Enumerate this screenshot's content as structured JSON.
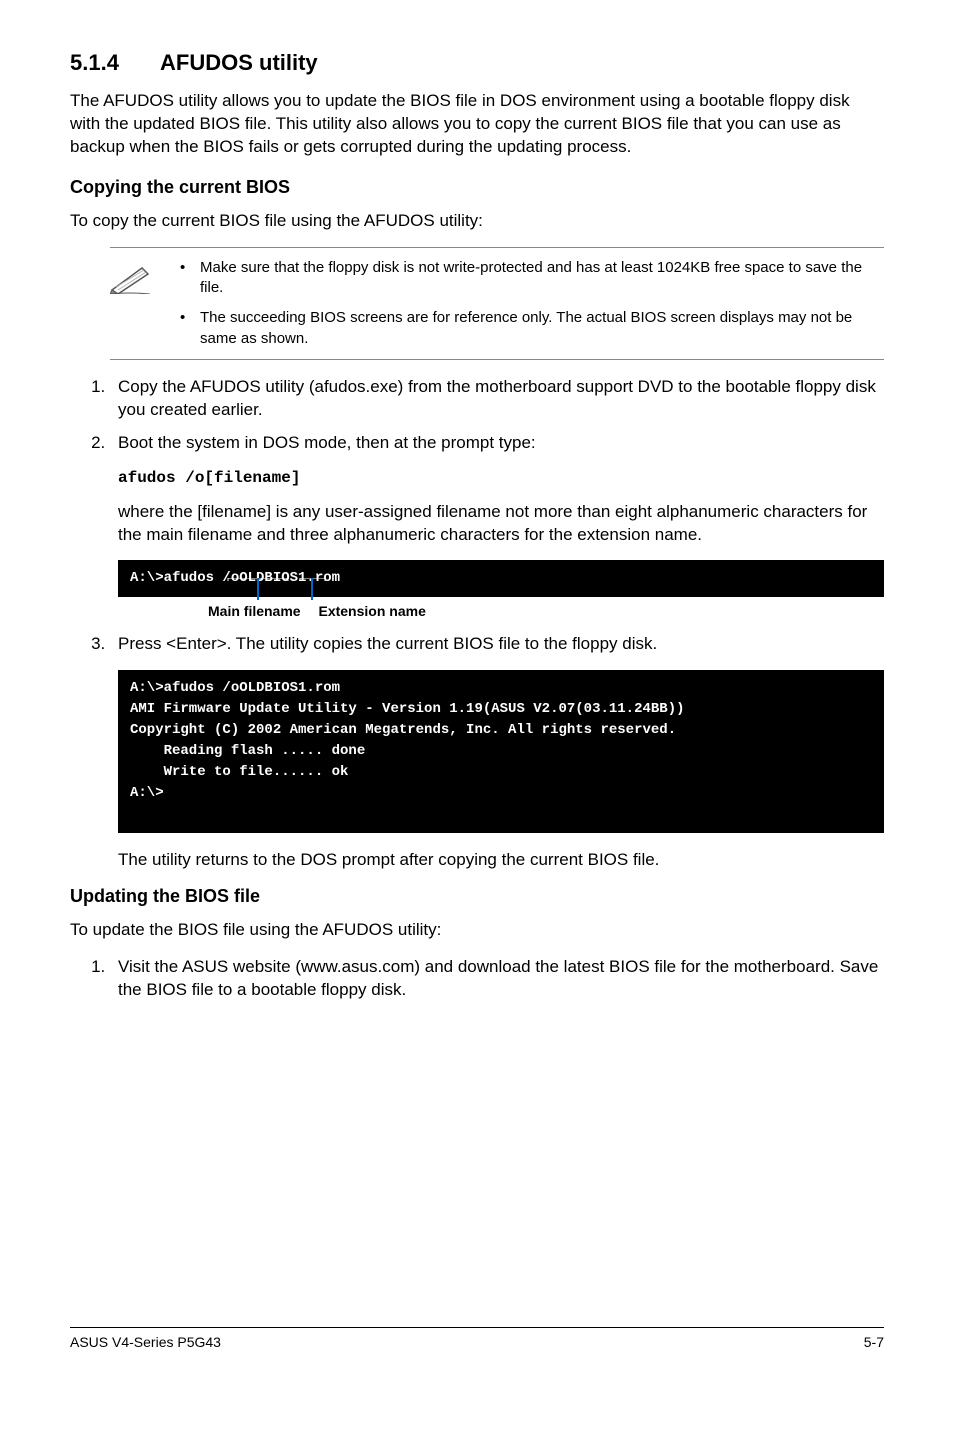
{
  "heading": {
    "number": "5.1.4",
    "title": "AFUDOS utility"
  },
  "intro": "The AFUDOS utility allows you to update the BIOS file in DOS environment using a bootable floppy disk with the updated BIOS file. This utility also allows you to copy the current BIOS file that you can use as backup when the BIOS fails or gets corrupted during the updating process.",
  "copy_section": {
    "heading": "Copying the current BIOS",
    "lead": "To copy the current BIOS file using the AFUDOS utility:",
    "notes": [
      "Make sure that the floppy disk is not write-protected and has at least 1024KB free space to save the file.",
      "The succeeding BIOS screens are for reference only. The actual BIOS screen displays may not be same as shown."
    ],
    "steps12": [
      "Copy the AFUDOS utility (afudos.exe) from the motherboard support DVD to the bootable floppy disk you created earlier.",
      "Boot the system in DOS mode, then at the prompt type:"
    ],
    "code": "afudos /o[filename]",
    "code_explain": "where the [filename] is any user-assigned filename not more than eight alphanumeric characters  for the main filename and three alphanumeric characters for the extension name.",
    "term1": "A:\\>afudos /oOLDBIOS1.rom",
    "anno_main": "Main filename",
    "anno_ext": "Extension name",
    "step3": "Press <Enter>. The utility copies the current BIOS file to the floppy disk.",
    "term2": "A:\\>afudos /oOLDBIOS1.rom\nAMI Firmware Update Utility - Version 1.19(ASUS V2.07(03.11.24BB))\nCopyright (C) 2002 American Megatrends, Inc. All rights reserved.\n    Reading flash ..... done\n    Write to file...... ok\nA:\\>\n ",
    "after": "The utility returns to the DOS prompt after copying the current BIOS file."
  },
  "update_section": {
    "heading": "Updating the BIOS file",
    "lead": "To update the BIOS file using the AFUDOS utility:",
    "steps": [
      "Visit the ASUS website (www.asus.com) and download the latest BIOS file for the motherboard. Save the BIOS file to a bootable floppy disk."
    ]
  },
  "footer": {
    "left": "ASUS V4-Series P5G43",
    "right": "5-7"
  }
}
